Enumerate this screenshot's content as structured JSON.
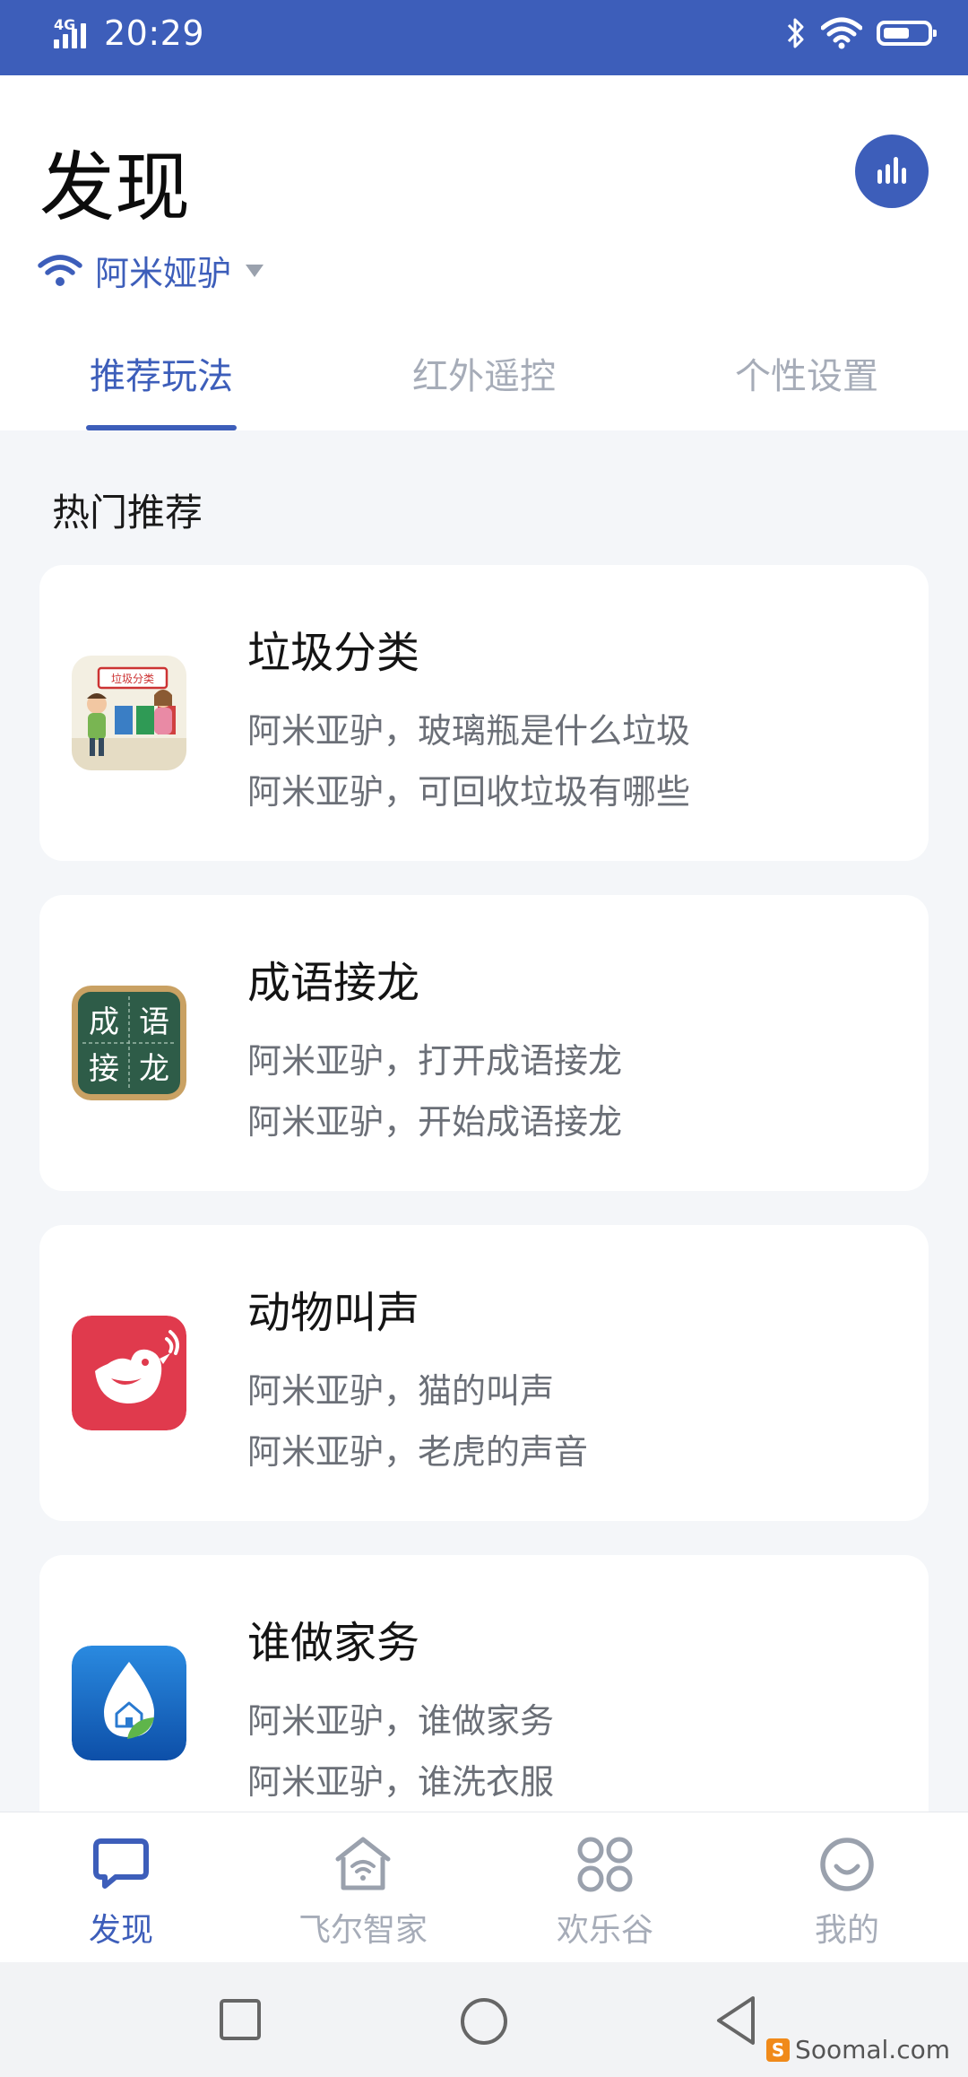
{
  "status_bar": {
    "network": "4G",
    "time": "20:29",
    "battery_level": 0.6
  },
  "header": {
    "title": "发现",
    "chart_button_icon": "bar-chart-icon",
    "device": {
      "wifi_icon": "wifi-icon",
      "name": "阿米娅驴"
    }
  },
  "tabs": [
    {
      "label": "推荐玩法",
      "active": true
    },
    {
      "label": "红外遥控",
      "active": false
    },
    {
      "label": "个性设置",
      "active": false
    }
  ],
  "section": {
    "title": "热门推荐"
  },
  "cards": [
    {
      "icon": "garbage-sorting-icon",
      "icon_text": "垃圾分类",
      "title": "垃圾分类",
      "lines": [
        "阿米亚驴，玻璃瓶是什么垃圾",
        "阿米亚驴，可回收垃圾有哪些"
      ]
    },
    {
      "icon": "idiom-chain-icon",
      "icon_text": [
        "成",
        "语",
        "接",
        "龙"
      ],
      "title": "成语接龙",
      "lines": [
        "阿米亚驴，打开成语接龙",
        "阿米亚驴，开始成语接龙"
      ]
    },
    {
      "icon": "bird-icon",
      "title": "动物叫声",
      "lines": [
        "阿米亚驴，猫的叫声",
        "阿米亚驴，老虎的声音"
      ]
    },
    {
      "icon": "house-drop-icon",
      "title": "谁做家务",
      "lines": [
        "阿米亚驴，谁做家务",
        "阿米亚驴，谁洗衣服"
      ]
    }
  ],
  "bottom_nav": [
    {
      "label": "发现",
      "icon": "chat-bubble-icon",
      "active": true
    },
    {
      "label": "飞尔智家",
      "icon": "smart-home-icon",
      "active": false
    },
    {
      "label": "欢乐谷",
      "icon": "apps-grid-icon",
      "active": false
    },
    {
      "label": "我的",
      "icon": "smiley-icon",
      "active": false
    }
  ],
  "system_nav": {
    "recent": "square-icon",
    "home": "circle-icon",
    "back": "triangle-back-icon"
  },
  "watermark": {
    "logo_letter": "S",
    "text": "Soomal.com"
  },
  "colors": {
    "accent": "#3d5eba",
    "inactive": "#a6acb8",
    "card_text": "#6b6f77",
    "background": "#f4f6f9"
  }
}
